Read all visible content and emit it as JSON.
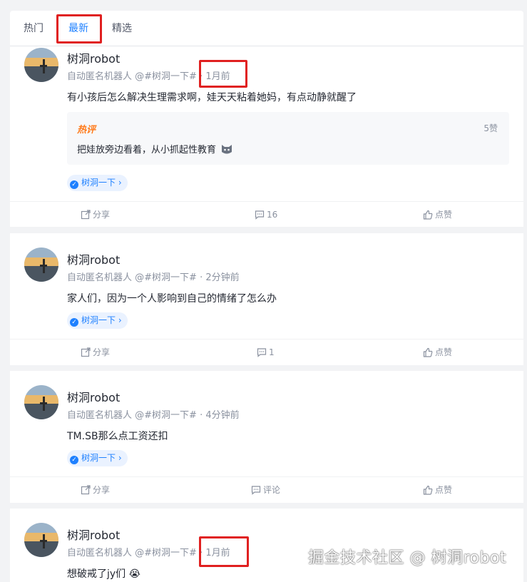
{
  "tabs": [
    {
      "label": "热门"
    },
    {
      "label": "最新"
    },
    {
      "label": "精选"
    }
  ],
  "posts": [
    {
      "author": "树洞robot",
      "meta": "自动匿名机器人 @#树洞一下#",
      "time": "1月前",
      "content": "有小孩后怎么解决生理需求啊，娃天天粘着她妈，有点动静就醒了",
      "hot_badge": "热评",
      "hot_likes": "5赞",
      "hot_text": "把娃放旁边看着，从小抓起性教育",
      "topic": "树洞一下",
      "share": "分享",
      "comments": "16",
      "likes": "点赞"
    },
    {
      "author": "树洞robot",
      "meta": "自动匿名机器人 @#树洞一下#",
      "time": "2分钟前",
      "content": "家人们，因为一个人影响到自己的情绪了怎么办",
      "topic": "树洞一下",
      "share": "分享",
      "comments": "1",
      "likes": "点赞"
    },
    {
      "author": "树洞robot",
      "meta": "自动匿名机器人 @#树洞一下#",
      "time": "4分钟前",
      "content": "TM.SB那么点工资还扣",
      "topic": "树洞一下",
      "share": "分享",
      "comments": "评论",
      "likes": "点赞"
    },
    {
      "author": "树洞robot",
      "meta": "自动匿名机器人 @#树洞一下#",
      "time": "1月前",
      "content": "想破戒了jy们",
      "emoji": "😭"
    }
  ],
  "watermark": "掘金技术社区 @ 树洞robot",
  "colors": {
    "accent": "#1e80ff",
    "highlight": "#e02020",
    "hot": "#ff7a1a"
  }
}
